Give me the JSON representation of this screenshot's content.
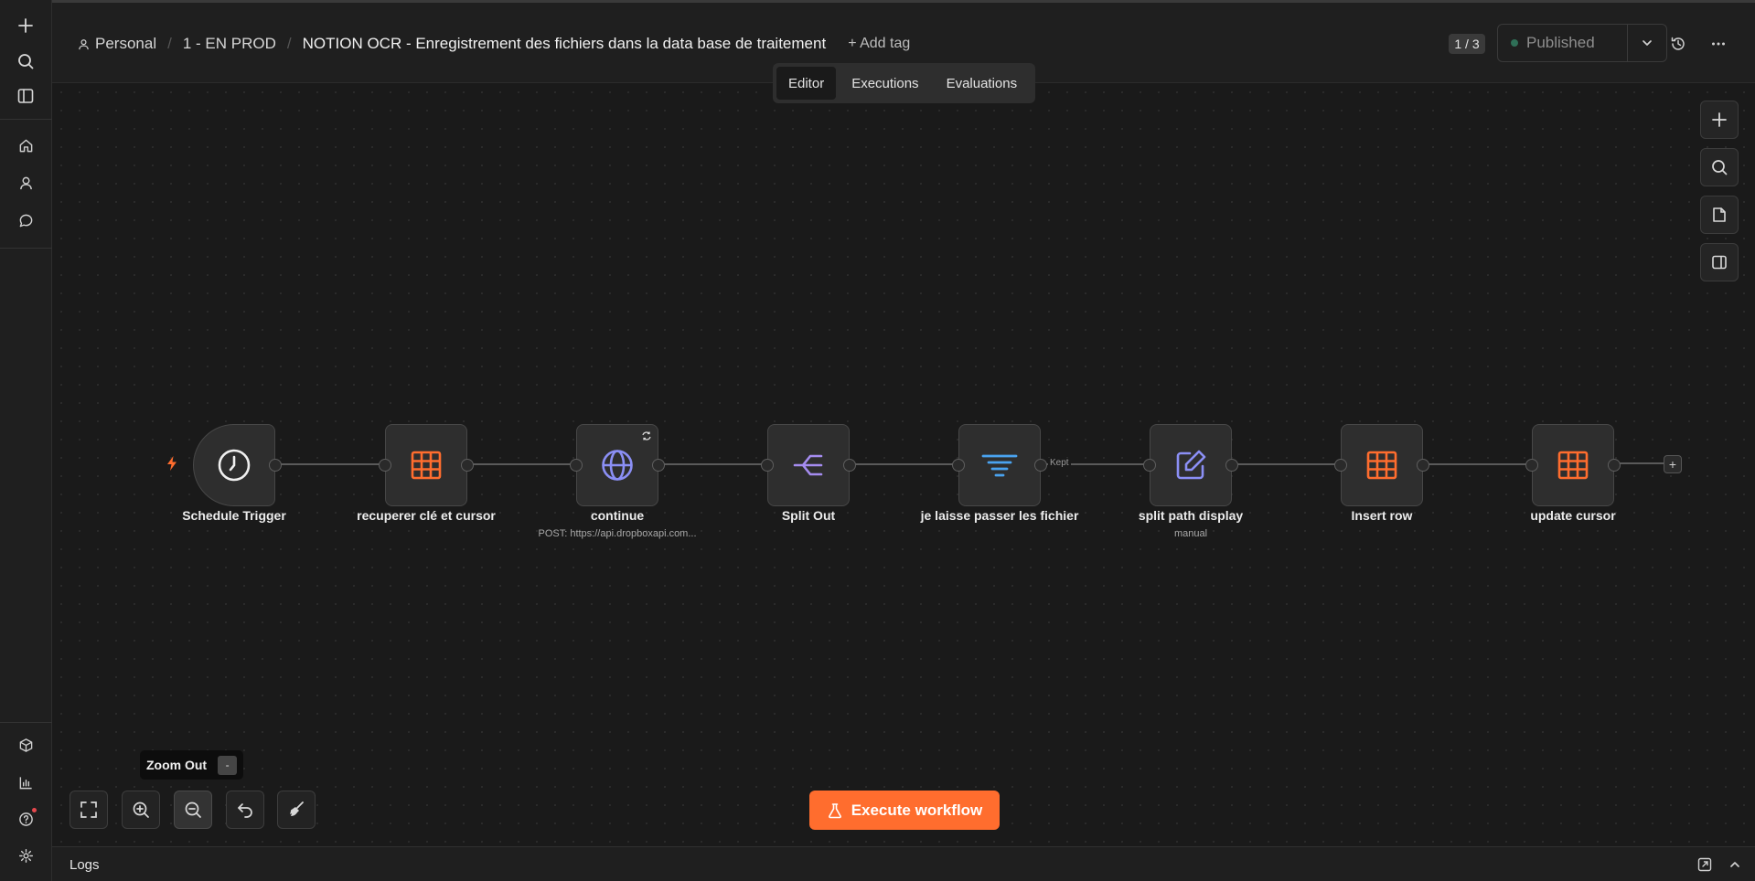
{
  "header": {
    "breadcrumb": {
      "project": "Personal",
      "folder": "1 - EN PROD",
      "workflow_title": "NOTION OCR - Enregistrement des fichiers dans la data base de traitement"
    },
    "add_tag_label": "+ Add tag",
    "version_counter": "1 / 3",
    "publish_status": "Published",
    "tabs": [
      {
        "label": "Editor",
        "active": true
      },
      {
        "label": "Executions",
        "active": false
      },
      {
        "label": "Evaluations",
        "active": false
      }
    ]
  },
  "nodes": [
    {
      "label": "Schedule Trigger",
      "icon": "clock-icon"
    },
    {
      "label": "recuperer clé et cursor",
      "icon": "table-icon"
    },
    {
      "label": "continue",
      "subtitle": "POST: https://api.dropboxapi.com...",
      "icon": "globe-icon"
    },
    {
      "label": "Split Out",
      "icon": "split-icon"
    },
    {
      "label": "je laisse passer les fichier",
      "icon": "filter-icon"
    },
    {
      "label": "split path display",
      "subtitle": "manual",
      "icon": "edit-icon"
    },
    {
      "label": "Insert row",
      "icon": "table-icon"
    },
    {
      "label": "update cursor",
      "icon": "table-icon"
    }
  ],
  "connection_labels": {
    "kept": "Kept"
  },
  "tooltip": {
    "label": "Zoom Out",
    "shortcut": "-"
  },
  "execute_button": {
    "label": "Execute workflow"
  },
  "logs": {
    "label": "Logs"
  },
  "colors": {
    "accent": "#ff6d2e",
    "table_icon": "#ff6d2e",
    "http_icon": "#8b8ff5",
    "split_icon": "#a58cf0",
    "filter_icon": "#4aa3f0"
  }
}
